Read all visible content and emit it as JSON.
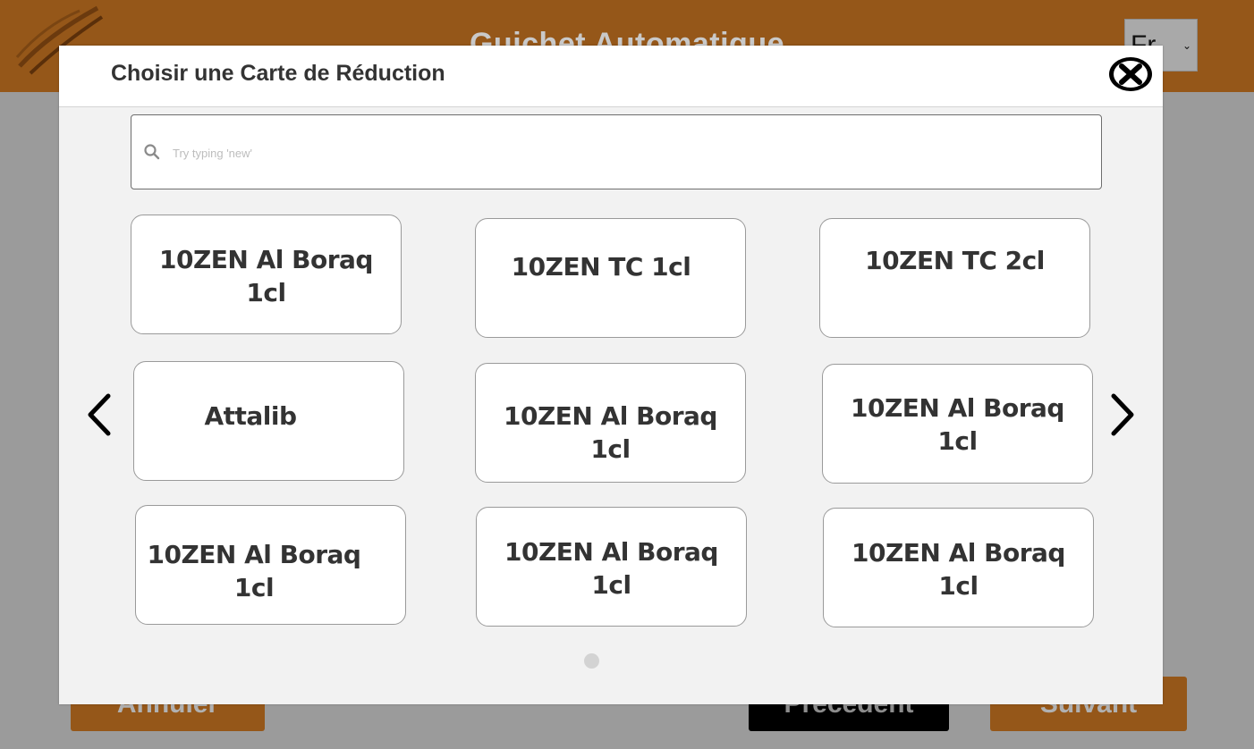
{
  "header": {
    "title": "Guichet Automatique",
    "language": "Fr",
    "accent_color": "#955719"
  },
  "footer": {
    "cancel_label": "Annuler",
    "previous_label": "Précédent",
    "next_label": "Suivant"
  },
  "modal": {
    "title": "Choisir une Carte de Réduction",
    "close_icon": "close-circle-icon",
    "search": {
      "placeholder": "Try typing 'new'",
      "value": ""
    },
    "cards": [
      {
        "label": "10ZEN Al Boraq 1cl"
      },
      {
        "label": "10ZEN TC 1cl"
      },
      {
        "label": "10ZEN TC 2cl"
      },
      {
        "label": "Attalib"
      },
      {
        "label": "10ZEN Al Boraq 1cl"
      },
      {
        "label": "10ZEN Al Boraq 1cl"
      },
      {
        "label": "10ZEN Al Boraq 1cl"
      },
      {
        "label": "10ZEN Al Boraq 1cl"
      },
      {
        "label": "10ZEN Al Boraq 1cl"
      }
    ],
    "pagination": {
      "current_page": 1,
      "total_pages": 1
    }
  }
}
